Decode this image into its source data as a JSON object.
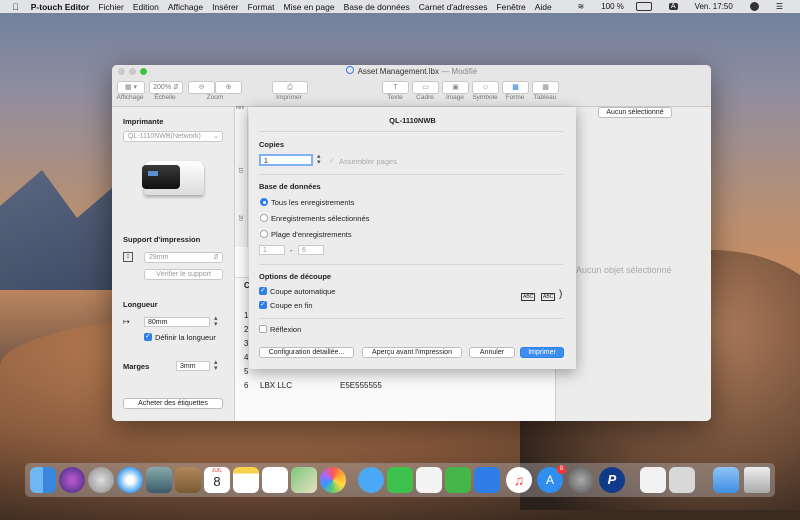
{
  "menubar": {
    "apple": "",
    "app": "P-touch Editor",
    "items": [
      "Fichier",
      "Edition",
      "Affichage",
      "Insérer",
      "Format",
      "Mise en page",
      "Base de données",
      "Carnet d'adresses",
      "Fenêtre",
      "Aide"
    ],
    "battery": "100 %",
    "input": "A",
    "clock": "Ven. 17:50"
  },
  "window": {
    "title": "Asset Management.lbx",
    "modified": "— Modifié",
    "toolbar": {
      "zoom_value": "200%",
      "labels": [
        "Affichage",
        "Échelle",
        "Zoom",
        "Imprimer",
        "Texte",
        "Cadre",
        "Image",
        "Symbole",
        "Forme",
        "Tableau"
      ]
    },
    "side": {
      "printer_header": "Imprimante",
      "printer_value": "QL-1110NWB(Network)",
      "media_header": "Support d'impression",
      "media_value": "29mm",
      "verify_btn": "Vérifier le support",
      "length_header": "Longueur",
      "length_value": "80mm",
      "define_length": "Définir la longueur",
      "margins_header": "Marges",
      "margins_value": "3mm",
      "buy_btn": "Acheter des étiquettes"
    },
    "canvas": {
      "ruler_unit": "mm",
      "ruler_ticks": [
        "10",
        "20"
      ],
      "rows": [
        "C",
        "1",
        "2",
        "3",
        "4",
        "5",
        "6"
      ],
      "last_row_name": "LBX LLC",
      "last_row_code": "E5E555555"
    },
    "right": {
      "none_btn": "Aucun sélectionné",
      "none_text": "Aucun objet sélectionné"
    }
  },
  "sheet": {
    "printer": "QL-1110NWB",
    "copies_header": "Copies",
    "copies_value": "1",
    "collate": "Assembler pages",
    "db_header": "Base de données",
    "opt_all": "Tous les enregistrements",
    "opt_selected": "Enregistrements sélectionnés",
    "opt_range": "Plage d'enregistrements",
    "range_from": "1",
    "range_dash": "-",
    "range_to": "6",
    "cut_header": "Options de découpe",
    "auto_cut": "Coupe automatique",
    "end_cut": "Coupe en fin",
    "cut_preview": "ABC",
    "reflection": "Réflexion",
    "btn_config": "Configuration détaillée...",
    "btn_preview": "Aperçu avant l'impression",
    "btn_cancel": "Annuler",
    "btn_print": "Imprimer"
  },
  "dock_calendar": {
    "month": "JUIL",
    "day": "8"
  },
  "dock_badge": "8"
}
